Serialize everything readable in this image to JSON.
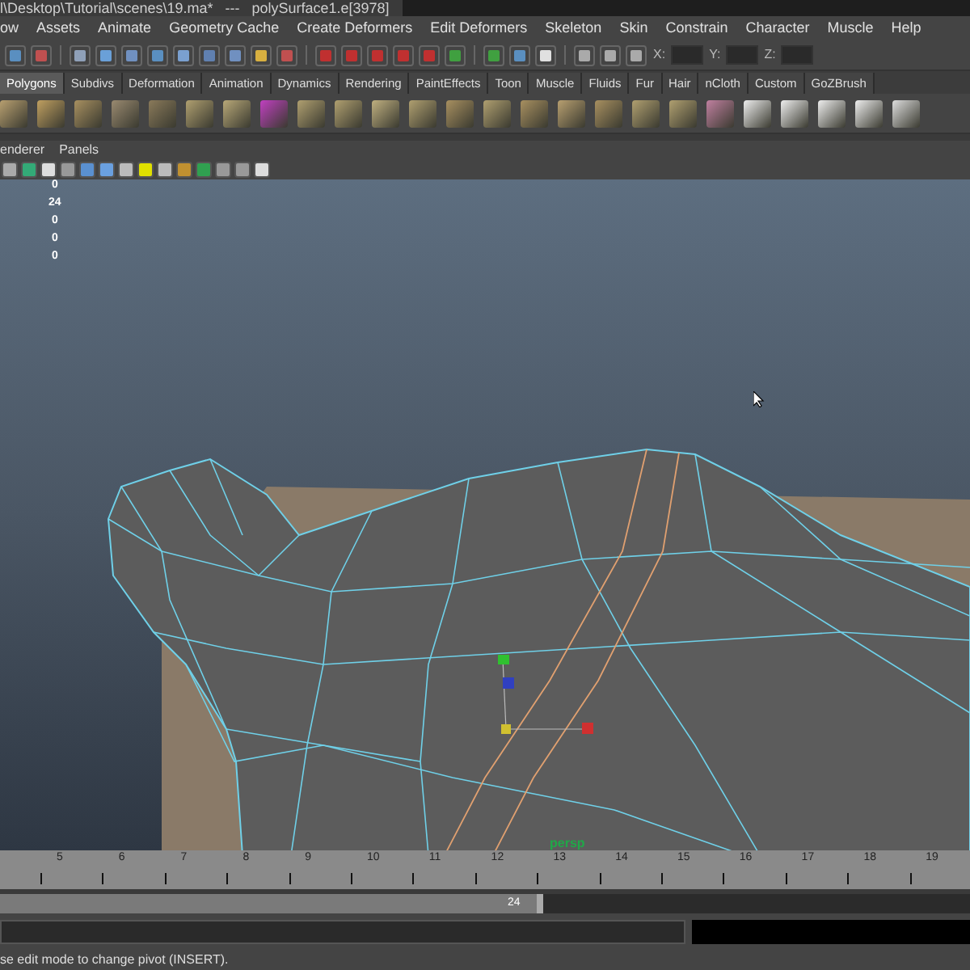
{
  "window": {
    "title": "l\\Desktop\\Tutorial\\scenes\\19.ma*   ---   polySurface1.e[3978]"
  },
  "menu_bar": [
    "ow",
    "Assets",
    "Animate",
    "Geometry Cache",
    "Create Deformers",
    "Edit Deformers",
    "Skeleton",
    "Skin",
    "Constrain",
    "Character",
    "Muscle",
    "Help"
  ],
  "status_line": {
    "fields": [
      {
        "label": "X:"
      },
      {
        "label": "Y:"
      },
      {
        "label": "Z:"
      }
    ]
  },
  "shelf_tabs": [
    {
      "label": "Polygons",
      "selected": true
    },
    {
      "label": "Subdivs",
      "selected": false
    },
    {
      "label": "Deformation",
      "selected": false
    },
    {
      "label": "Animation",
      "selected": false
    },
    {
      "label": "Dynamics",
      "selected": false
    },
    {
      "label": "Rendering",
      "selected": false
    },
    {
      "label": "PaintEffects",
      "selected": false
    },
    {
      "label": "Toon",
      "selected": false
    },
    {
      "label": "Muscle",
      "selected": false
    },
    {
      "label": "Fluids",
      "selected": false
    },
    {
      "label": "Fur",
      "selected": false
    },
    {
      "label": "Hair",
      "selected": false
    },
    {
      "label": "nCloth",
      "selected": false
    },
    {
      "label": "Custom",
      "selected": false
    },
    {
      "label": "GoZBrush",
      "selected": false
    }
  ],
  "panel_menu": [
    "enderer",
    "Panels"
  ],
  "viewport": {
    "hud": [
      "0",
      "24",
      "0",
      "0",
      "0"
    ],
    "camera": "persp"
  },
  "time_slider": {
    "ticks": [
      "5",
      "6",
      "7",
      "8",
      "9",
      "10",
      "11",
      "12",
      "13",
      "14",
      "15",
      "16",
      "17",
      "18",
      "19"
    ]
  },
  "range_slider": {
    "value": "24",
    "level": 0.56
  },
  "help_line": "se edit mode to change pivot (INSERT)."
}
